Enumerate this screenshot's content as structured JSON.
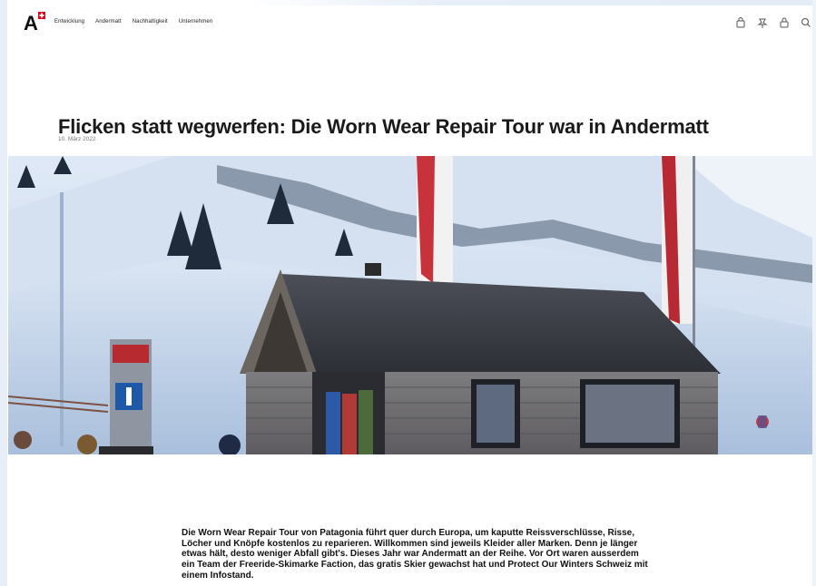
{
  "header": {
    "logo_name": "A",
    "nav": [
      "Entwicklung",
      "Andermatt",
      "Nachhaltigkeit",
      "Unternehmen"
    ],
    "icons": [
      "shopping-bag-icon",
      "pin-icon",
      "lock-icon",
      "search-icon"
    ]
  },
  "article": {
    "title": "Flicken statt wegwerfen: Die Worn Wear Repair Tour war in Andermatt",
    "date": "10. März 2022",
    "body": "Die Worn Wear Repair Tour von Patagonia führt quer durch Europa, um kaputte Reissverschlüsse, Risse, Löcher und Knöpfe kostenlos zu reparieren. Willkommen sind jeweils Kleider aller Marken. Denn je länger etwas hält, desto weniger Abfall gibt's. Dieses Jahr war Andermatt an der Reihe. Vor Ort waren ausserdem ein Team der Freeride-Skimarke Faction, das gratis Skier gewachst hat und Protect Our Winters Schweiz mit einem Infostand."
  },
  "colors": {
    "accent": "#e2001a",
    "text": "#111111",
    "muted": "#777777",
    "sky": "#cfdff2",
    "snow": "#e9f0f9"
  }
}
